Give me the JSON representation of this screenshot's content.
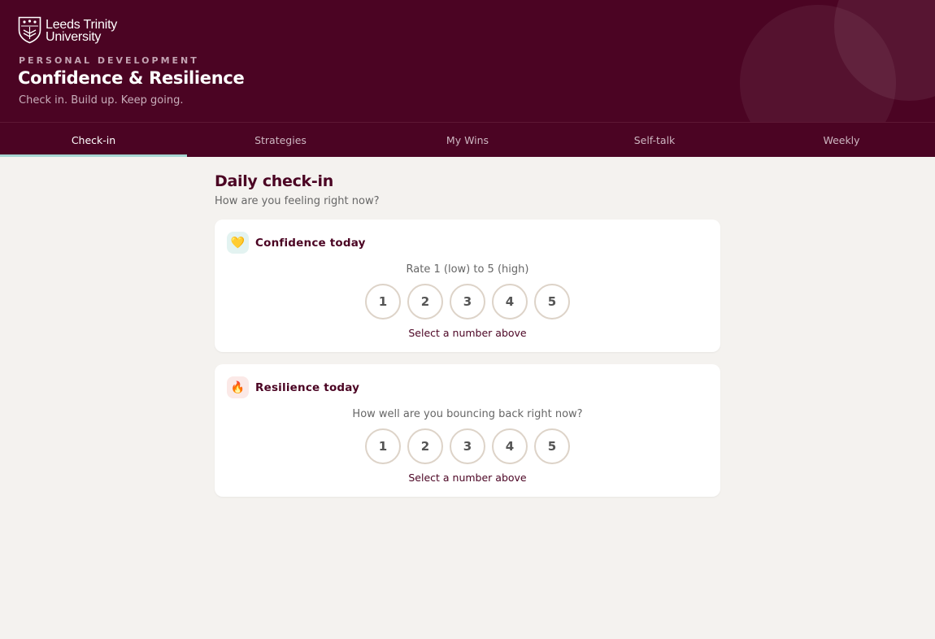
{
  "brand": {
    "line1": "Leeds Trinity",
    "line2": "University"
  },
  "header": {
    "eyebrow": "PERSONAL DEVELOPMENT",
    "title": "Confidence & Resilience",
    "subtitle": "Check in. Build up. Keep going."
  },
  "tabs": [
    {
      "label": "Check-in",
      "active": true
    },
    {
      "label": "Strategies"
    },
    {
      "label": "My Wins"
    },
    {
      "label": "Self-talk"
    },
    {
      "label": "Weekly"
    }
  ],
  "main": {
    "title": "Daily check-in",
    "subtitle": "How are you feeling right now?"
  },
  "cards": [
    {
      "icon": "yellow-heart-icon",
      "icon_glyph": "💛",
      "title": "Confidence today",
      "prompt": "Rate 1 (low) to 5 (high)",
      "options": [
        "1",
        "2",
        "3",
        "4",
        "5"
      ],
      "status": "Select a number above"
    },
    {
      "icon": "fire-icon",
      "icon_glyph": "🔥",
      "title": "Resilience today",
      "prompt": "How well are you bouncing back right now?",
      "options": [
        "1",
        "2",
        "3",
        "4",
        "5"
      ],
      "status": "Select a number above"
    }
  ],
  "colors": {
    "brand": "#4b0423",
    "accent": "#a6d6d2",
    "background": "#f4f2ef"
  }
}
